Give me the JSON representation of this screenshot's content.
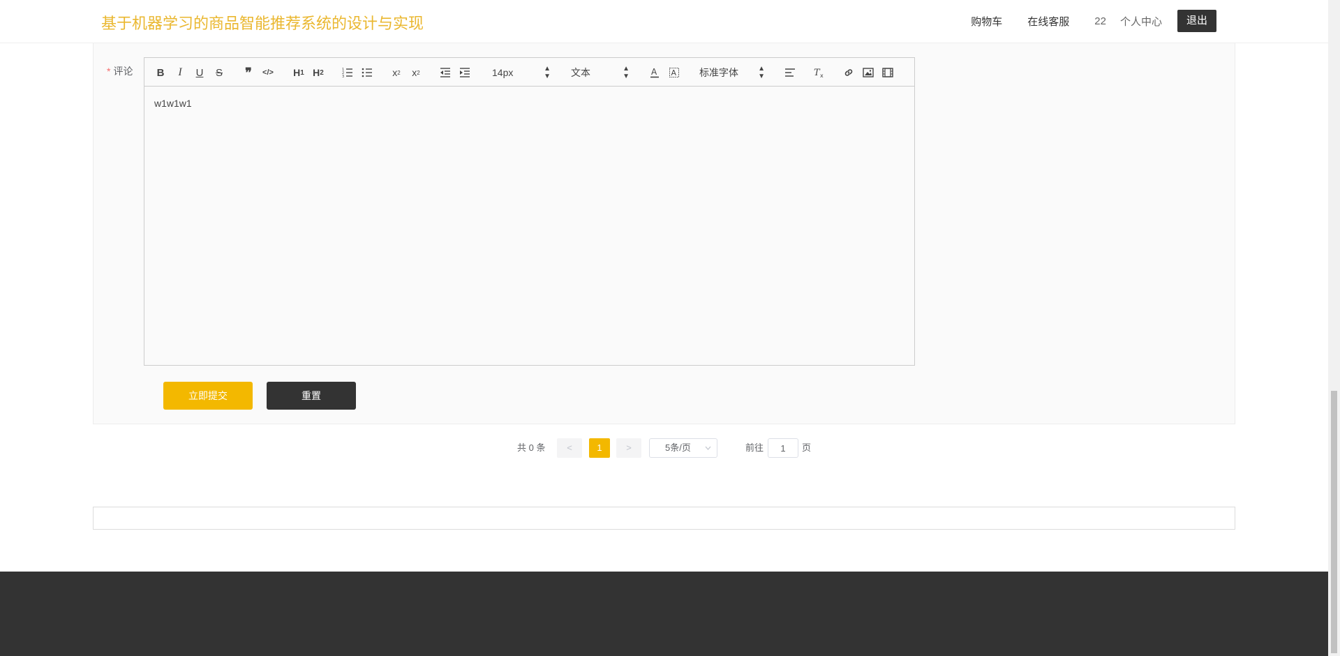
{
  "header": {
    "title": "基于机器学习的商品智能推荐系统的设计与实现",
    "nav": {
      "cart": "购物车",
      "service": "在线客服",
      "username": "22",
      "profile": "个人中心",
      "logout": "退出"
    }
  },
  "form": {
    "required_mark": "*",
    "comment_label": "评论",
    "editor": {
      "font_size": "14px",
      "header_select": "文本",
      "font_family": "标准字体",
      "content": "w1w1w1"
    },
    "submit_label": "立即提交",
    "reset_label": "重置"
  },
  "pagination": {
    "total_text": "共 0 条",
    "prev": "<",
    "current_page": "1",
    "next": ">",
    "page_size": "5条/页",
    "goto_label": "前往",
    "goto_value": "1",
    "page_label": "页"
  },
  "colors": {
    "brand": "#eab72f",
    "primary": "#f3b800",
    "dark": "#333333"
  },
  "toolbar_icons": [
    "bold-icon",
    "italic-icon",
    "underline-icon",
    "strike-icon",
    "blockquote-icon",
    "code-block-icon",
    "h1-icon",
    "h2-icon",
    "ordered-list-icon",
    "bullet-list-icon",
    "subscript-icon",
    "superscript-icon",
    "outdent-icon",
    "indent-icon",
    "font-color-icon",
    "background-color-icon",
    "align-icon",
    "clear-format-icon",
    "link-icon",
    "image-icon",
    "video-icon"
  ]
}
